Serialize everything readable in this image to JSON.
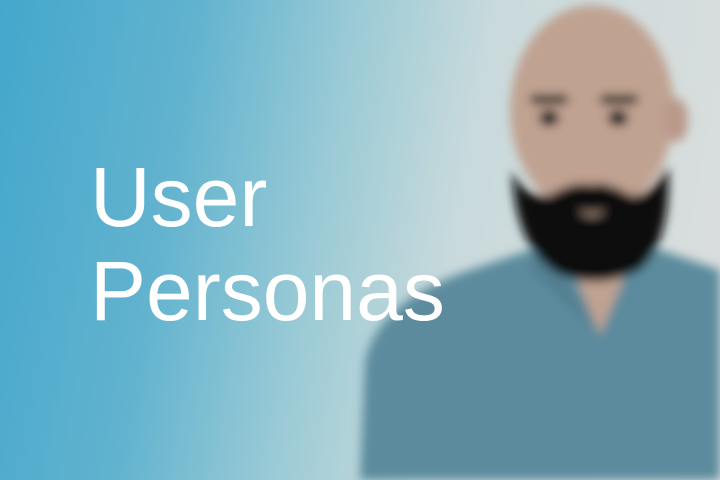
{
  "title": {
    "line1": "User",
    "line2": "Personas"
  },
  "colors": {
    "background_left": "#44a7cc",
    "background_right": "#dcdedd",
    "skin": "#c0a291",
    "beard": "#0d0d0d",
    "shirt": "#5b8b9d",
    "text": "#ffffff"
  }
}
